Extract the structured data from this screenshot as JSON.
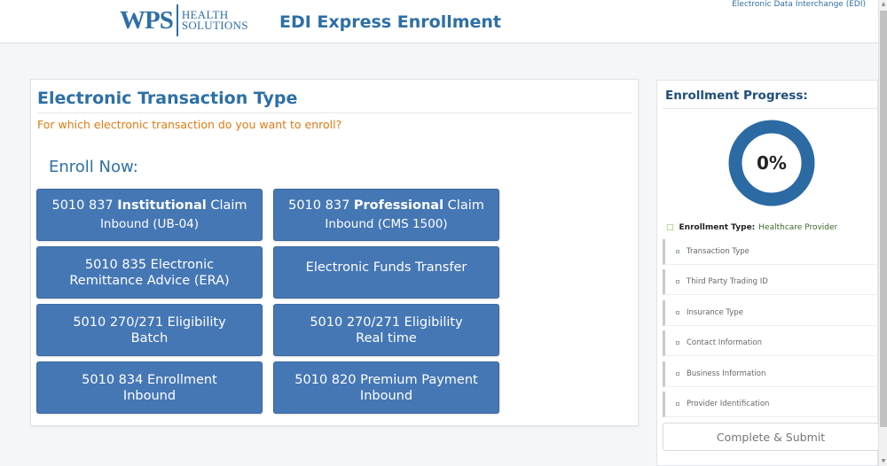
{
  "header": {
    "logo_main": "WPS",
    "logo_sub_1": "HEALTH",
    "logo_sub_2": "SOLUTIONS",
    "app_title": "EDI Express Enrollment",
    "top_link": "Electronic Data Interchange (EDI)"
  },
  "main": {
    "title": "Electronic Transaction Type",
    "subtitle": "For which electronic transaction do you want to enroll?",
    "enroll_now": "Enroll Now:",
    "buttons": [
      {
        "prefix": "5010 837 ",
        "bold": "Institutional",
        "suffix": " Claim",
        "line2": "Inbound (UB-04)"
      },
      {
        "prefix": "5010 837 ",
        "bold": "Professional",
        "suffix": " Claim",
        "line2": "Inbound (CMS 1500)"
      },
      {
        "line1": "5010 835 Electronic",
        "line2": "Remittance Advice (ERA)"
      },
      {
        "line1": "Electronic Funds Transfer",
        "line2": ""
      },
      {
        "line1": "5010 270/271 Eligibility",
        "line2": "Batch"
      },
      {
        "line1": "5010 270/271 Eligibility",
        "line2": "Real time"
      },
      {
        "line1": "5010 834 Enrollment",
        "line2": "Inbound"
      },
      {
        "line1": "5010 820 Premium Payment",
        "line2": "Inbound"
      }
    ]
  },
  "sidebar": {
    "title": "Enrollment Progress:",
    "progress_label": "0%",
    "progress_value": 0,
    "enrollment_type_label": "Enrollment Type:",
    "enrollment_type_value": "Healthcare Provider",
    "steps": [
      "Transaction Type",
      "Third Party Trading ID",
      "Insurance Type",
      "Contact Information",
      "Business Information",
      "Provider Identification"
    ],
    "submit_label": "Complete & Submit"
  },
  "colors": {
    "brand_blue": "#2d6fa6",
    "button_blue": "#4577b5",
    "donut_blue": "#2b6aa3",
    "subtitle_orange": "#e07a12",
    "check_green": "#7cc04a"
  }
}
